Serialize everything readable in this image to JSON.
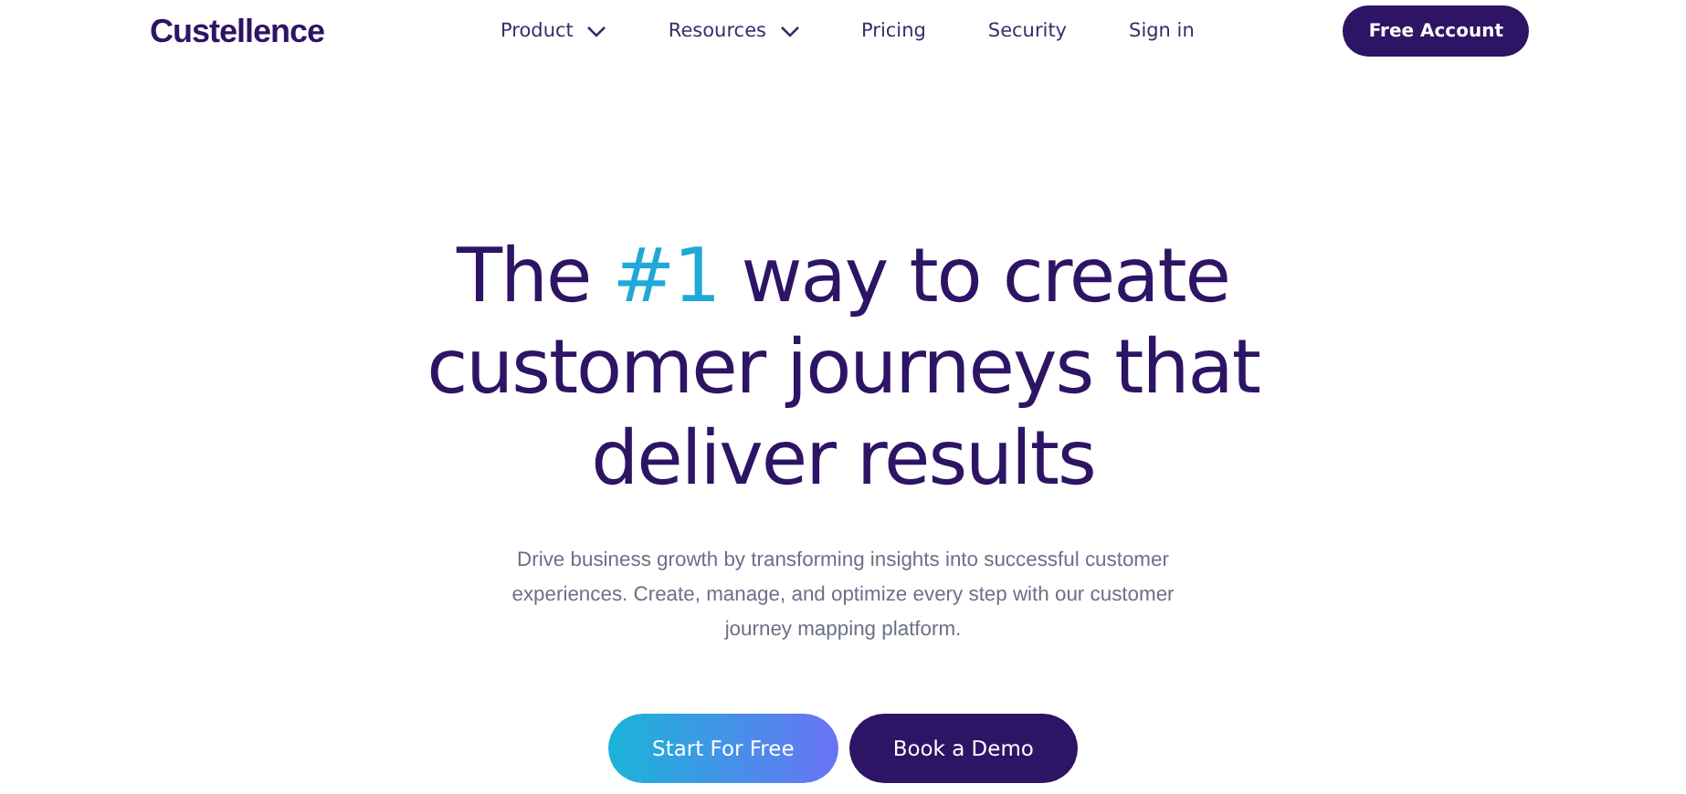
{
  "header": {
    "logo": "Custellence",
    "nav": [
      {
        "label": "Product",
        "dropdown": true
      },
      {
        "label": "Resources",
        "dropdown": true
      },
      {
        "label": "Pricing",
        "dropdown": false
      },
      {
        "label": "Security",
        "dropdown": false
      },
      {
        "label": "Sign in",
        "dropdown": false
      }
    ],
    "cta": "Free Account"
  },
  "hero": {
    "headline": {
      "before": "The ",
      "accent": "#1",
      "after": " way to create customer journeys that deliver results"
    },
    "description": "Drive business growth by transforming insights into successful customer experiences. Create, manage, and optimize every step with our customer journey mapping platform.",
    "buttons": [
      {
        "label": "Start For Free",
        "kind": "gradient"
      },
      {
        "label": "Book a Demo",
        "kind": "dark"
      }
    ]
  }
}
